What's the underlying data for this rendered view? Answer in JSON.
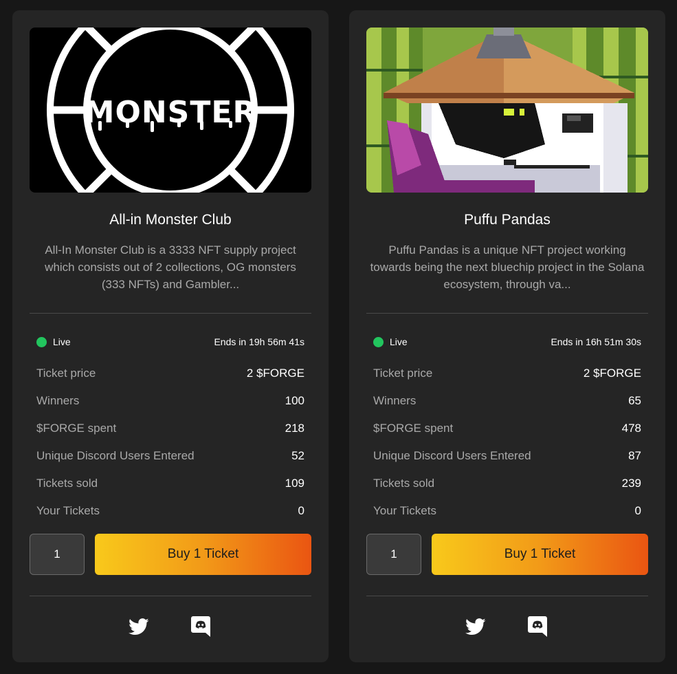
{
  "cards": [
    {
      "image": {
        "alt": "MONSTER",
        "logo_text": "MONSTER"
      },
      "title": "All-in Monster Club",
      "description": "All-In Monster Club is a 3333 NFT supply project which consists out of 2 collections, OG monsters (333 NFTs) and Gambler...",
      "status": "Live",
      "ends": "Ends in 19h 56m 41s",
      "stats": [
        {
          "label": "Ticket price",
          "value": "2 $FORGE"
        },
        {
          "label": "Winners",
          "value": "100"
        },
        {
          "label": "$FORGE spent",
          "value": "218"
        },
        {
          "label": "Unique Discord Users Entered",
          "value": "52"
        },
        {
          "label": "Tickets sold",
          "value": "109"
        },
        {
          "label": "Your Tickets",
          "value": "0"
        }
      ],
      "quantity": "1",
      "buy_label": "Buy 1 Ticket",
      "icons": {
        "twitter": "twitter-icon",
        "discord": "discord-icon"
      }
    },
    {
      "image": {
        "alt": "Puffu Pandas artwork"
      },
      "title": "Puffu Pandas",
      "description": "Puffu Pandas is a unique NFT project working towards being the next bluechip project in the Solana ecosystem, through va...",
      "status": "Live",
      "ends": "Ends in 16h 51m 30s",
      "stats": [
        {
          "label": "Ticket price",
          "value": "2 $FORGE"
        },
        {
          "label": "Winners",
          "value": "65"
        },
        {
          "label": "$FORGE spent",
          "value": "478"
        },
        {
          "label": "Unique Discord Users Entered",
          "value": "87"
        },
        {
          "label": "Tickets sold",
          "value": "239"
        },
        {
          "label": "Your Tickets",
          "value": "0"
        }
      ],
      "quantity": "1",
      "buy_label": "Buy 1 Ticket",
      "icons": {
        "twitter": "twitter-icon",
        "discord": "discord-icon"
      }
    }
  ],
  "colors": {
    "page_bg": "#171717",
    "card_bg": "#252525",
    "live": "#22c55e",
    "button_gradient_start": "#f8c91b",
    "button_gradient_end": "#ea5512"
  }
}
